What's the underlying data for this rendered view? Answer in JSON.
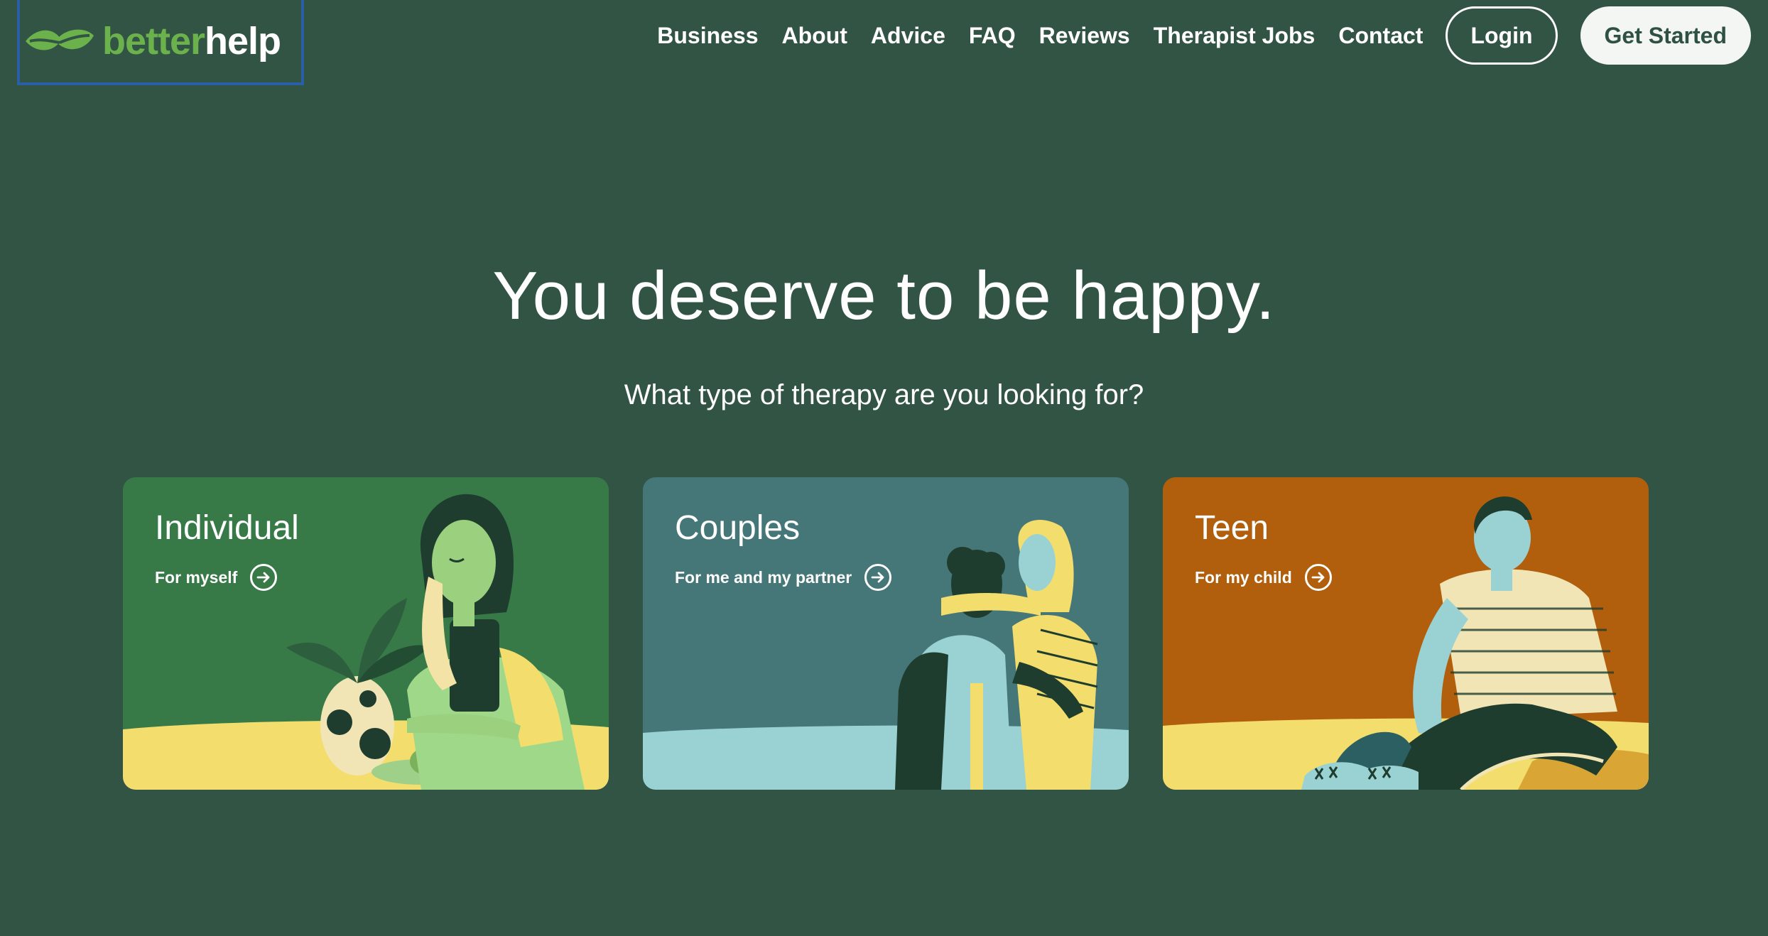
{
  "header": {
    "logo": {
      "part1": "better",
      "part2": "help"
    },
    "nav": [
      "Business",
      "About",
      "Advice",
      "FAQ",
      "Reviews",
      "Therapist Jobs",
      "Contact"
    ],
    "login_label": "Login",
    "get_started_label": "Get Started"
  },
  "hero": {
    "title": "You deserve to be happy.",
    "subtitle": "What type of therapy are you looking for?"
  },
  "cards": [
    {
      "title": "Individual",
      "link": "For myself",
      "color": "#377a47"
    },
    {
      "title": "Couples",
      "link": "For me and my partner",
      "color": "#457678"
    },
    {
      "title": "Teen",
      "link": "For my child",
      "color": "#b15f0d"
    }
  ],
  "colors": {
    "background": "#325445",
    "brand_green": "#6cb24c",
    "focus_outline": "#2a5ea6"
  }
}
